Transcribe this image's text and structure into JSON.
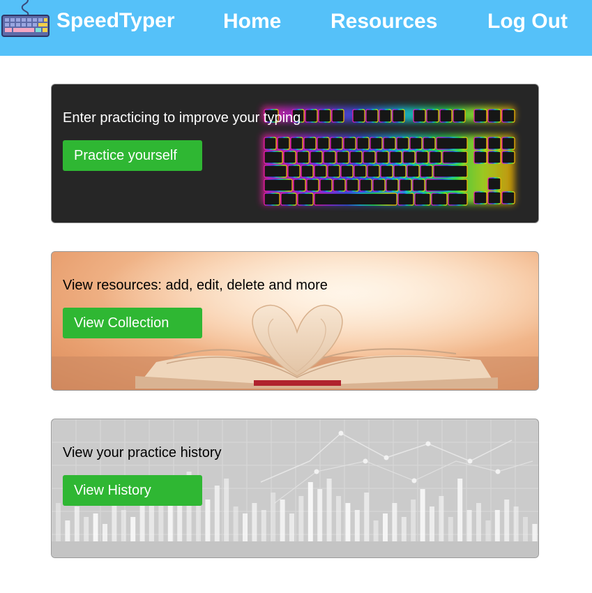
{
  "navbar": {
    "brand": "SpeedTyper",
    "logo_icon": "keyboard-icon",
    "links": {
      "home": "Home",
      "resources": "Resources",
      "logout": "Log Out"
    },
    "background": "#55c1f9"
  },
  "cards": [
    {
      "text": "Enter practicing to improve your typing",
      "button": "Practice yourself",
      "image": "rgb-keyboard-image"
    },
    {
      "text": "View resources: add, edit, delete and more",
      "button": "View Collection",
      "image": "open-book-heart-image"
    },
    {
      "text": "View your practice history",
      "button": "View History",
      "image": "statistics-graph-image"
    }
  ],
  "colors": {
    "button": "#2fb733",
    "card1_bg": "#262626",
    "card3_bg": "#cbcbcb"
  }
}
